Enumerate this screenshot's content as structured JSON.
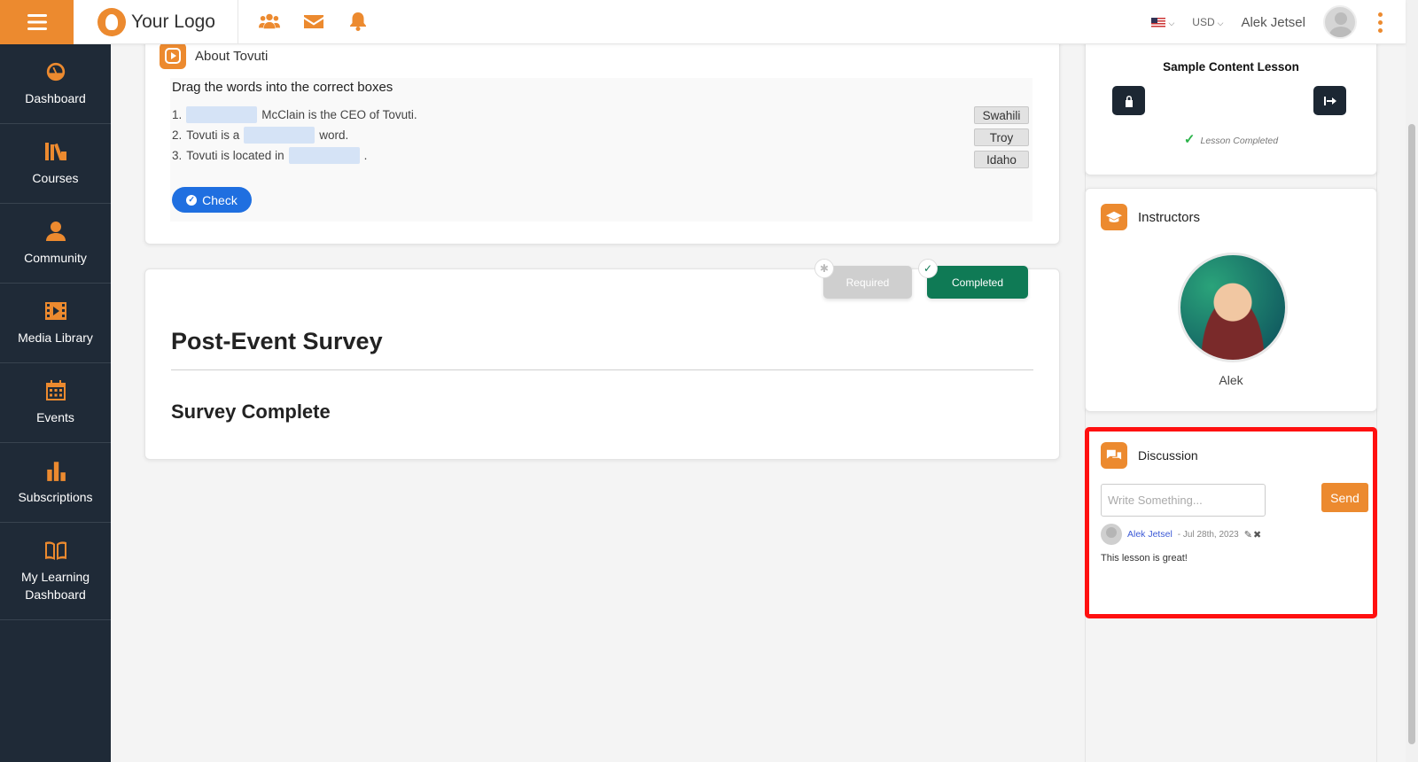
{
  "header": {
    "logo_text": "Your Logo",
    "nav_icons": [
      "users-icon",
      "envelope-icon",
      "bell-icon"
    ],
    "currency": "USD",
    "user_name": "Alek Jetsel"
  },
  "sidebar": {
    "items": [
      {
        "label": "Dashboard",
        "icon": "dashboard-gauge-icon"
      },
      {
        "label": "Courses",
        "icon": "books-icon"
      },
      {
        "label": "Community",
        "icon": "community-icon"
      },
      {
        "label": "Media Library",
        "icon": "film-icon"
      },
      {
        "label": "Events",
        "icon": "calendar-icon"
      },
      {
        "label": "Subscriptions",
        "icon": "bar-chart-icon"
      },
      {
        "label": "My Learning Dashboard",
        "icon": "open-book-icon"
      }
    ]
  },
  "about": {
    "title": "About Tovuti",
    "instructions": "Drag the words into the correct boxes",
    "lines": [
      {
        "num": "1.",
        "before": "",
        "after": "McClain is the CEO of Tovuti."
      },
      {
        "num": "2.",
        "before": "Tovuti is a",
        "after": "word."
      },
      {
        "num": "3.",
        "before": "Tovuti is located in",
        "after": "."
      }
    ],
    "options": [
      "Swahili",
      "Troy",
      "Idaho"
    ],
    "check_label": "Check"
  },
  "survey": {
    "required_label": "Required",
    "completed_label": "Completed",
    "title": "Post-Event Survey",
    "subtitle": "Survey Complete"
  },
  "lesson": {
    "title": "Sample Content Lesson",
    "status": "Lesson Completed"
  },
  "instructors": {
    "title": "Instructors",
    "name": "Alek"
  },
  "discussion": {
    "title": "Discussion",
    "placeholder": "Write Something...",
    "send_label": "Send",
    "comment": {
      "author": "Alek Jetsel",
      "date": "- Jul 28th, 2023",
      "text": "This lesson is great!"
    }
  },
  "colors": {
    "accent": "#ec8a2f",
    "sidebar_bg": "#1f2a37",
    "check_blue": "#1f6fe0",
    "completed_green": "#0f7a55",
    "highlight_red": "#ff1010"
  }
}
